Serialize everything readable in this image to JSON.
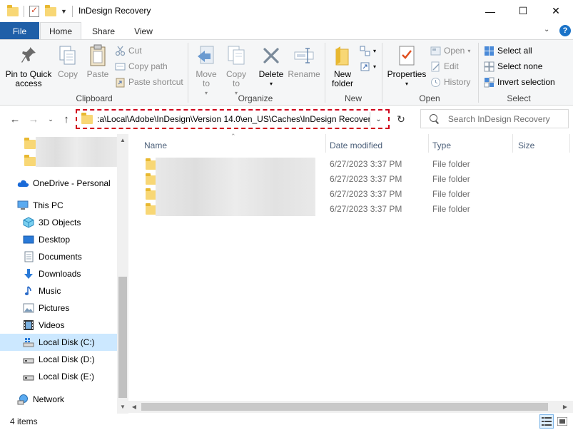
{
  "window": {
    "title": "InDesign Recovery",
    "minimize_glyph": "—",
    "maximize_glyph": "☐",
    "close_glyph": "✕"
  },
  "ribbon_tabs": {
    "file": "File",
    "home": "Home",
    "share": "Share",
    "view": "View",
    "collapse_glyph": "⌄",
    "help_glyph": "?"
  },
  "clipboard": {
    "label": "Clipboard",
    "pin": "Pin to Quick access",
    "copy": "Copy",
    "paste": "Paste",
    "cut": "Cut",
    "copy_path": "Copy path",
    "paste_shortcut": "Paste shortcut"
  },
  "organize": {
    "label": "Organize",
    "move_to": "Move to",
    "copy_to": "Copy to",
    "delete": "Delete",
    "rename": "Rename"
  },
  "new_group": {
    "label": "New",
    "new_folder": "New folder"
  },
  "open_group": {
    "label": "Open",
    "properties": "Properties",
    "open": "Open",
    "edit": "Edit",
    "history": "History"
  },
  "select_group": {
    "label": "Select",
    "select_all": "Select all",
    "select_none": "Select none",
    "invert_selection": "Invert selection"
  },
  "address": {
    "path": ":a\\Local\\Adobe\\InDesign\\Version 14.0\\en_US\\Caches\\InDesign Recovery",
    "highlight_color": "#d0021b"
  },
  "search": {
    "placeholder": "Search InDesign Recovery"
  },
  "nav_pane": {
    "onedrive": "OneDrive - Personal",
    "this_pc": "This PC",
    "objects_3d": "3D Objects",
    "desktop": "Desktop",
    "documents": "Documents",
    "downloads": "Downloads",
    "music": "Music",
    "pictures": "Pictures",
    "videos": "Videos",
    "local_c": "Local Disk (C:)",
    "local_d": "Local Disk (D:)",
    "local_e": "Local Disk (E:)",
    "network": "Network"
  },
  "columns": {
    "name": "Name",
    "date_modified": "Date modified",
    "type": "Type",
    "size": "Size"
  },
  "rows": [
    {
      "date": "6/27/2023 3:37 PM",
      "type": "File folder"
    },
    {
      "date": "6/27/2023 3:37 PM",
      "type": "File folder"
    },
    {
      "date": "6/27/2023 3:37 PM",
      "type": "File folder"
    },
    {
      "date": "6/27/2023 3:37 PM",
      "type": "File folder"
    }
  ],
  "status": {
    "items_count": "4 items"
  },
  "colors": {
    "accent": "#1f5fa8",
    "selection": "#cce8ff",
    "folder": "#f8d775"
  }
}
